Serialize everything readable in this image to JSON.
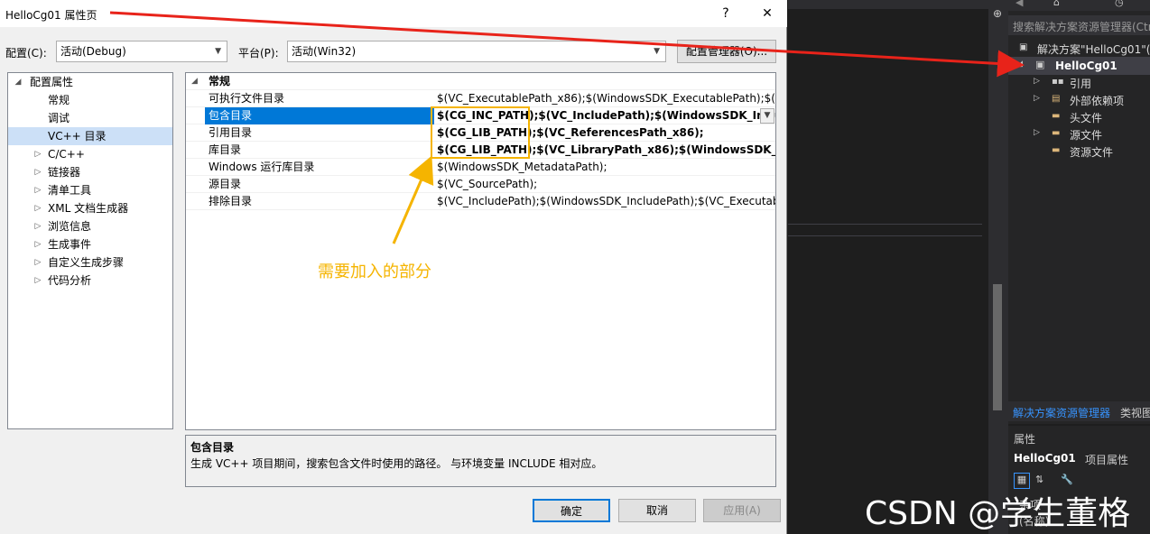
{
  "dialog": {
    "title": "HelloCg01 属性页",
    "help_label": "?",
    "close_label": "✕",
    "config_label": "配置(C):",
    "config_value": "活动(Debug)",
    "platform_label": "平台(P):",
    "platform_value": "活动(Win32)",
    "config_manager_label": "配置管理器(O)..."
  },
  "tree": {
    "root": "配置属性",
    "items": [
      {
        "label": "常规",
        "expand": ""
      },
      {
        "label": "调试",
        "expand": ""
      },
      {
        "label": "VC++ 目录",
        "expand": ""
      },
      {
        "label": "C/C++",
        "expand": "▷"
      },
      {
        "label": "链接器",
        "expand": "▷"
      },
      {
        "label": "清单工具",
        "expand": "▷"
      },
      {
        "label": "XML 文档生成器",
        "expand": "▷"
      },
      {
        "label": "浏览信息",
        "expand": "▷"
      },
      {
        "label": "生成事件",
        "expand": "▷"
      },
      {
        "label": "自定义生成步骤",
        "expand": "▷"
      },
      {
        "label": "代码分析",
        "expand": "▷"
      }
    ]
  },
  "grid": {
    "category": "常规",
    "rows": [
      {
        "name": "可执行文件目录",
        "value": "$(VC_ExecutablePath_x86);$(WindowsSDK_ExecutablePath);$(VS_E"
      },
      {
        "name": "包含目录",
        "value": "$(CG_INC_PATH);$(VC_IncludePath);$(WindowsSDK_Include"
      },
      {
        "name": "引用目录",
        "value": "$(CG_LIB_PATH);$(VC_ReferencesPath_x86);"
      },
      {
        "name": "库目录",
        "value": "$(CG_LIB_PATH);$(VC_LibraryPath_x86);$(WindowsSDK_Library"
      },
      {
        "name": "Windows 运行库目录",
        "value": "$(WindowsSDK_MetadataPath);"
      },
      {
        "name": "源目录",
        "value": "$(VC_SourcePath);"
      },
      {
        "name": "排除目录",
        "value": "$(VC_IncludePath);$(WindowsSDK_IncludePath);$(VC_ExecutablePa"
      }
    ]
  },
  "annotation": "需要加入的部分",
  "description": {
    "title": "包含目录",
    "text": "生成 VC++ 项目期间，搜索包含文件时使用的路径。 与环境变量 INCLUDE 相对应。"
  },
  "buttons": {
    "ok": "确定",
    "cancel": "取消",
    "apply": "应用(A)"
  },
  "solution_explorer": {
    "search_placeholder": "搜索解决方案资源管理器(Ctrl",
    "solution": "解决方案\"HelloCg01\"(",
    "project": "HelloCg01",
    "nodes": [
      "引用",
      "外部依赖项",
      "头文件",
      "源文件",
      "资源文件"
    ],
    "tab_active": "解决方案资源管理器",
    "tab_other": "类视图"
  },
  "properties_panel": {
    "header": "属性",
    "object": "HelloCg01",
    "object_type": "项目属性",
    "row1": "杂项",
    "row2": "(名称)"
  },
  "watermark": "CSDN @学生董格",
  "colors": {
    "selection": "#0078d7",
    "annotation": "#f5b400",
    "arrow": "#e8231a"
  }
}
